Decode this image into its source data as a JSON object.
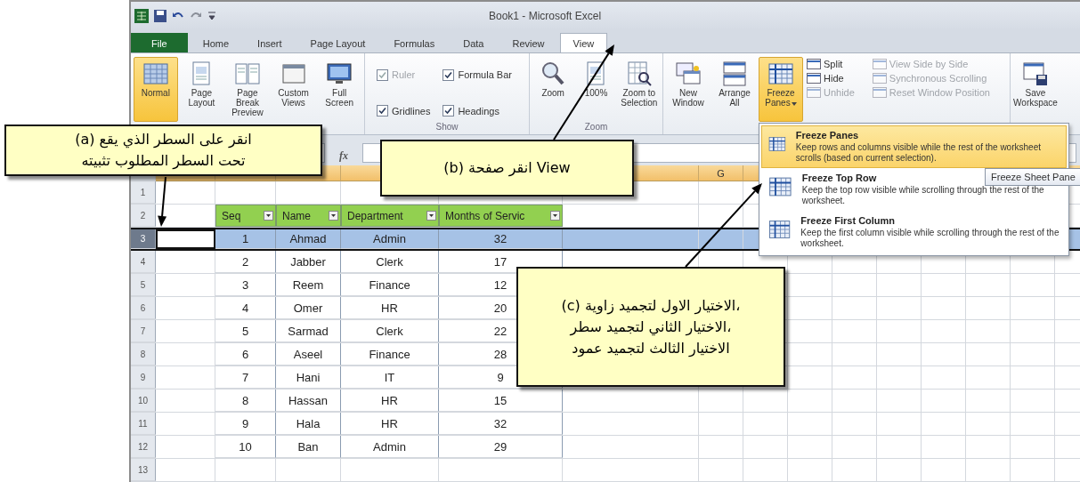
{
  "window": {
    "title": "Book1 - Microsoft Excel"
  },
  "tabs": [
    {
      "label": "File",
      "kind": "file",
      "selected": false
    },
    {
      "label": "Home",
      "kind": "tab",
      "selected": false
    },
    {
      "label": "Insert",
      "kind": "tab",
      "selected": false
    },
    {
      "label": "Page Layout",
      "kind": "tab",
      "selected": false
    },
    {
      "label": "Formulas",
      "kind": "tab",
      "selected": false
    },
    {
      "label": "Data",
      "kind": "tab",
      "selected": false
    },
    {
      "label": "Review",
      "kind": "tab",
      "selected": false
    },
    {
      "label": "View",
      "kind": "tab",
      "selected": true
    }
  ],
  "ribbon": {
    "groups": [
      {
        "kind": "views",
        "buttons": [
          {
            "label": "Normal",
            "selected": true
          },
          {
            "label": "Page Layout",
            "selected": false
          },
          {
            "label": "Page Break Preview",
            "selected": false
          },
          {
            "label": "Custom Views",
            "selected": false
          },
          {
            "label": "Full Screen",
            "selected": false
          }
        ]
      },
      {
        "kind": "show",
        "label": "Show",
        "checks": [
          {
            "label": "Ruler",
            "checked": true,
            "disabled": true
          },
          {
            "label": "Formula Bar",
            "checked": true,
            "disabled": false
          },
          {
            "label": "Gridlines",
            "checked": true,
            "disabled": false
          },
          {
            "label": "Headings",
            "checked": true,
            "disabled": false
          }
        ]
      },
      {
        "kind": "zoom",
        "label": "Zoom",
        "buttons": [
          {
            "label": "Zoom",
            "selected": false
          },
          {
            "label": "100%",
            "selected": false
          },
          {
            "label": "Zoom to Selection",
            "selected": false
          }
        ]
      },
      {
        "kind": "window",
        "buttons": [
          {
            "label": "New Window",
            "selected": false
          },
          {
            "label": "Arrange All",
            "selected": false
          },
          {
            "label": "Freeze Panes",
            "selected": true
          }
        ],
        "small": [
          {
            "label": "Split",
            "disabled": false
          },
          {
            "label": "Hide",
            "disabled": false
          },
          {
            "label": "Unhide",
            "disabled": true
          }
        ],
        "side": [
          {
            "label": "View Side by Side",
            "disabled": true
          },
          {
            "label": "Synchronous Scrolling",
            "disabled": true
          },
          {
            "label": "Reset Window Position",
            "disabled": true
          }
        ]
      },
      {
        "kind": "save",
        "buttons": [
          {
            "label": "Save Workspace",
            "selected": false
          }
        ]
      }
    ]
  },
  "formula_bar": {
    "function_label": "fx"
  },
  "sheet": {
    "column_headers": [
      {
        "label": "G"
      }
    ],
    "columns": [
      "Seq",
      "Name",
      "Department",
      "Months of Servic"
    ],
    "rows": [
      {
        "number": "1",
        "kind": "blank",
        "selected": false
      },
      {
        "number": "2",
        "kind": "header",
        "selected": false
      },
      {
        "number": "3",
        "kind": "data",
        "selected": true,
        "cells": [
          "1",
          "Ahmad",
          "Admin",
          "32"
        ]
      },
      {
        "number": "4",
        "kind": "data",
        "selected": false,
        "cells": [
          "2",
          "Jabber",
          "Clerk",
          "17"
        ]
      },
      {
        "number": "5",
        "kind": "data",
        "selected": false,
        "cells": [
          "3",
          "Reem",
          "Finance",
          "12"
        ]
      },
      {
        "number": "6",
        "kind": "data",
        "selected": false,
        "cells": [
          "4",
          "Omer",
          "HR",
          "20"
        ]
      },
      {
        "number": "7",
        "kind": "data",
        "selected": false,
        "cells": [
          "5",
          "Sarmad",
          "Clerk",
          "22"
        ]
      },
      {
        "number": "8",
        "kind": "data",
        "selected": false,
        "cells": [
          "6",
          "Aseel",
          "Finance",
          "28"
        ]
      },
      {
        "number": "9",
        "kind": "data",
        "selected": false,
        "cells": [
          "7",
          "Hani",
          "IT",
          "9"
        ]
      },
      {
        "number": "10",
        "kind": "data",
        "selected": false,
        "cells": [
          "8",
          "Hassan",
          "HR",
          "15"
        ]
      },
      {
        "number": "11",
        "kind": "data",
        "selected": false,
        "cells": [
          "9",
          "Hala",
          "HR",
          "32"
        ]
      },
      {
        "number": "12",
        "kind": "data",
        "selected": false,
        "cells": [
          "10",
          "Ban",
          "Admin",
          "29"
        ]
      },
      {
        "number": "13",
        "kind": "blank",
        "selected": false
      }
    ]
  },
  "menu": {
    "items": [
      {
        "title": "Freeze Panes",
        "description": "Keep rows and columns visible while the rest of the worksheet scrolls (based on current selection).",
        "selected": true
      },
      {
        "title": "Freeze Top Row",
        "description": "Keep the top row visible while scrolling through the rest of the worksheet.",
        "selected": false
      },
      {
        "title": "Freeze First Column",
        "description": "Keep the first column visible while scrolling through the rest of the worksheet.",
        "selected": false
      }
    ]
  },
  "tooltip": {
    "text": "Freeze Sheet Pane"
  },
  "callouts": [
    {
      "text": "(a) انقر على السطر الذي يقع\nتحت السطر المطلوب تثبيته"
    },
    {
      "text": "(b) انقر صفحة View"
    },
    {
      "text": "(c) الاختيار الاول لتجميد زاوية،\nالاختيار الثاني لتجميد سطر،\nالاختيار الثالث لتجميد عمود"
    }
  ]
}
